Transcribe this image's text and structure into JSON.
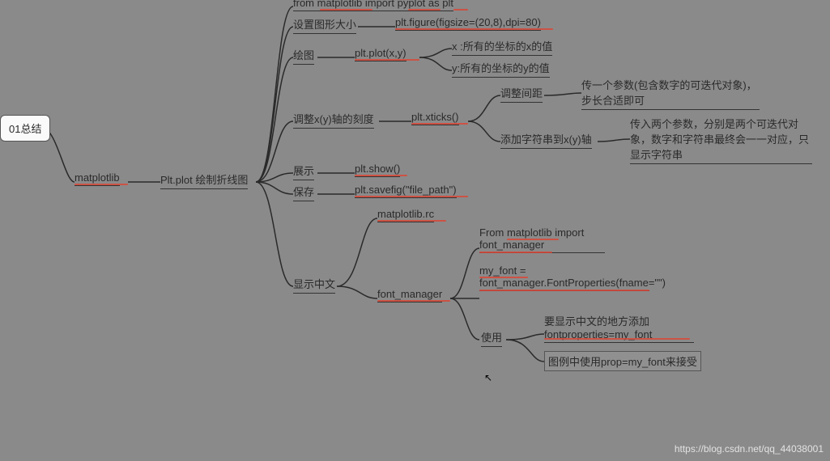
{
  "root": {
    "label": "01总结"
  },
  "level1": {
    "matplotlib": "matplotlib",
    "plt_plot": "Plt.plot 绘制折线图"
  },
  "branches": {
    "import": {
      "label": "from matplotlib import pyplot as plt"
    },
    "figsize": {
      "label": "设置图形大小",
      "code": "plt.figure(figsize=(20,8),dpi=80)"
    },
    "draw": {
      "label": "绘图",
      "code": "plt.plot(x,y)",
      "x_desc": "x :所有的坐标的x的值",
      "y_desc": "y:所有的坐标的y的值"
    },
    "ticks": {
      "label": "调整x(y)轴的刻度",
      "code": "plt.xticks()",
      "spacing": {
        "label": "调整间距",
        "desc": "传一个参数(包含数字的可迭代对象)，步长合适即可"
      },
      "strings": {
        "label": "添加字符串到x(y)轴",
        "desc": "传入两个参数，分别是两个可迭代对象，数字和字符串最终会一一对应，只显示字符串"
      }
    },
    "show": {
      "label": "展示",
      "code": "plt.show()"
    },
    "save": {
      "label": "保存",
      "code": "plt.savefig(\"file_path\")"
    },
    "chinese": {
      "label": "显示中文",
      "rc": "matplotlib.rc",
      "font_manager": {
        "label": "font_manager",
        "import": "From matplotlib import font_manager",
        "create": "my_font = font_manager.FontProperties(fname=\"\")",
        "use": {
          "label": "使用",
          "desc1": "要显示中文的地方添加fontproperties=my_font",
          "desc2": "图例中使用prop=my_font来接受"
        }
      }
    }
  },
  "watermark": "https://blog.csdn.net/qq_44038001"
}
